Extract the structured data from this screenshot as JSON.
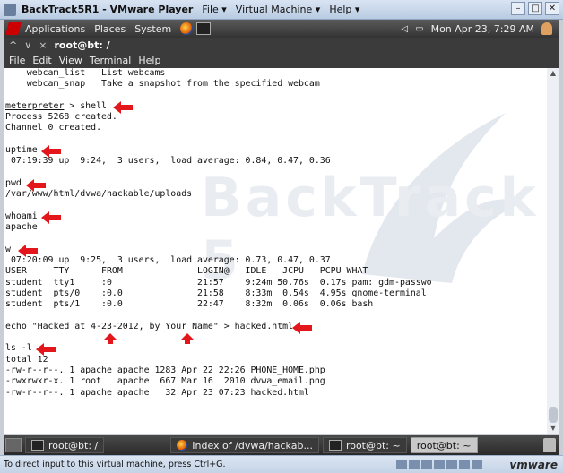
{
  "vm_window": {
    "title": "BackTrack5R1 - VMware Player",
    "menus": [
      "File ▾",
      "Virtual Machine ▾",
      "Help ▾"
    ]
  },
  "gnome_panel": {
    "menus": [
      "Applications",
      "Places",
      "System"
    ],
    "datetime": "Mon Apr 23,  7:29 AM"
  },
  "terminal": {
    "tab_title": "root@bt: /",
    "menu": [
      "File",
      "Edit",
      "View",
      "Terminal",
      "Help"
    ],
    "watermark": "BackTrack 5",
    "lines": [
      "    webcam_list   List webcams",
      "    webcam_snap   Take a snapshot from the specified webcam",
      "",
      "meterpreter > shell",
      "Process 5268 created.",
      "Channel 0 created.",
      "",
      "uptime",
      " 07:19:39 up  9:24,  3 users,  load average: 0.84, 0.47, 0.36",
      "",
      "pwd",
      "/var/www/html/dvwa/hackable/uploads",
      "",
      "whoami",
      "apache",
      "",
      "w",
      " 07:20:09 up  9:25,  3 users,  load average: 0.73, 0.47, 0.37",
      "USER     TTY      FROM              LOGIN@   IDLE   JCPU   PCPU WHAT",
      "student  tty1     :0                21:57    9:24m 50.76s  0.17s pam: gdm-passwo",
      "student  pts/0    :0.0              21:58    8:33m  0.54s  4.95s gnome-terminal",
      "student  pts/1    :0.0              22:47    8:32m  0.06s  0.06s bash",
      "",
      "echo \"Hacked at 4-23-2012, by Your Name\" > hacked.html",
      "",
      "ls -l",
      "total 12",
      "-rw-r--r--. 1 apache apache 1283 Apr 22 22:26 PHONE_HOME.php",
      "-rwxrwxr-x. 1 root   apache  667 Mar 16  2010 dvwa_email.png",
      "-rw-r--r--. 1 apache apache   32 Apr 23 07:23 hacked.html"
    ]
  },
  "taskbar": {
    "tasks": [
      "root@bt: /",
      "Index of /dvwa/hackab...",
      "root@bt: ~",
      "root@bt: ~"
    ]
  },
  "statusbar": {
    "hint": "To direct input to this virtual machine, press Ctrl+G.",
    "brand": "vmware"
  },
  "colors": {
    "arrow": "#e3161b",
    "terminal_bg": "#ffffff",
    "panel": "#333333"
  }
}
